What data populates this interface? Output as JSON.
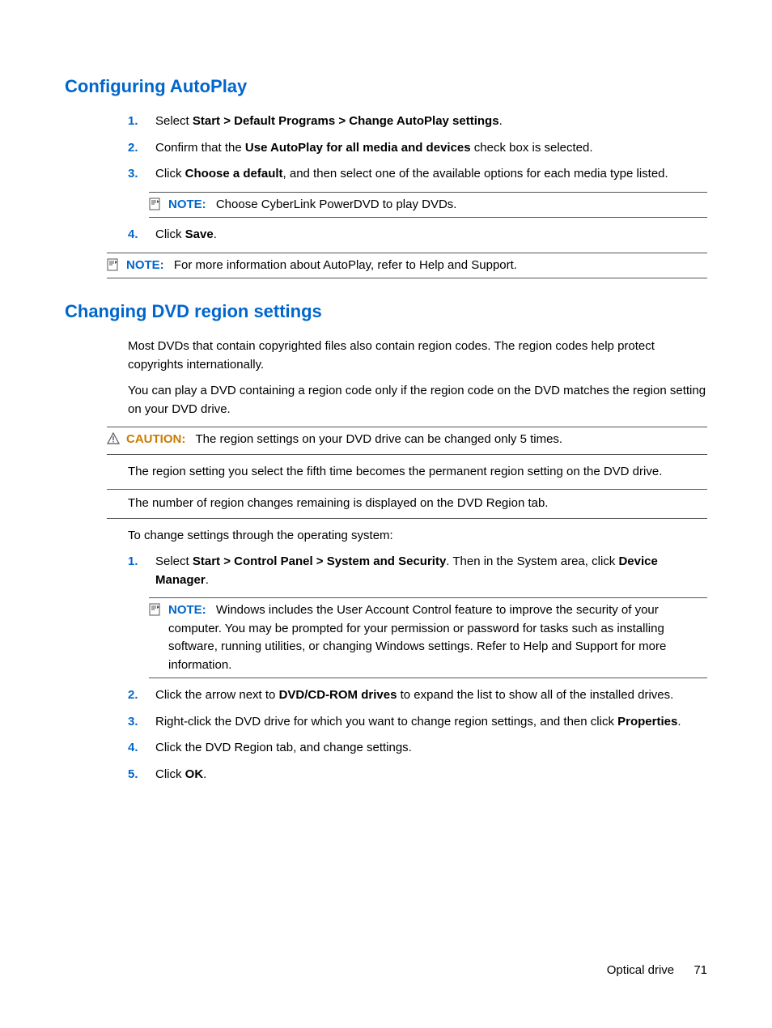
{
  "section1": {
    "heading": "Configuring AutoPlay",
    "steps": {
      "1": {
        "n": "1.",
        "pre": "Select ",
        "bold": "Start > Default Programs > Change AutoPlay settings",
        "post": "."
      },
      "2": {
        "n": "2.",
        "pre": "Confirm that the ",
        "bold": "Use AutoPlay for all media and devices",
        "post": " check box is selected."
      },
      "3": {
        "n": "3.",
        "pre": "Click ",
        "bold": "Choose a default",
        "post": ", and then select one of the available options for each media type listed."
      },
      "4": {
        "n": "4.",
        "pre": "Click ",
        "bold": "Save",
        "post": "."
      }
    },
    "note_inner": {
      "label": "NOTE:",
      "text": "Choose CyberLink PowerDVD to play DVDs."
    },
    "note_outer": {
      "label": "NOTE:",
      "text": "For more information about AutoPlay, refer to Help and Support."
    }
  },
  "section2": {
    "heading": "Changing DVD region settings",
    "p1": "Most DVDs that contain copyrighted files also contain region codes. The region codes help protect copyrights internationally.",
    "p2": "You can play a DVD containing a region code only if the region code on the DVD matches the region setting on your DVD drive.",
    "caution": {
      "label": "CAUTION:",
      "line1": "The region settings on your DVD drive can be changed only 5 times.",
      "line2": "The region setting you select the fifth time becomes the permanent region setting on the DVD drive.",
      "line3": "The number of region changes remaining is displayed on the DVD Region tab."
    },
    "p3": "To change settings through the operating system:",
    "steps": {
      "1": {
        "n": "1.",
        "pre": "Select ",
        "bold1": "Start > Control Panel > System and Security",
        "mid": ". Then in the System area, click ",
        "bold2": "Device Manager",
        "post": "."
      },
      "2": {
        "n": "2.",
        "pre": "Click the arrow next to ",
        "bold": "DVD/CD-ROM drives",
        "post": " to expand the list to show all of the installed drives."
      },
      "3": {
        "n": "3.",
        "pre": "Right-click the DVD drive for which you want to change region settings, and then click ",
        "bold": "Properties",
        "post": "."
      },
      "4": {
        "n": "4.",
        "text": "Click the DVD Region tab, and change settings."
      },
      "5": {
        "n": "5.",
        "pre": "Click ",
        "bold": "OK",
        "post": "."
      }
    },
    "note_inner": {
      "label": "NOTE:",
      "text": "Windows includes the User Account Control feature to improve the security of your computer. You may be prompted for your permission or password for tasks such as installing software, running utilities, or changing Windows settings. Refer to Help and Support for more information."
    }
  },
  "footer": {
    "section": "Optical drive",
    "page": "71"
  }
}
